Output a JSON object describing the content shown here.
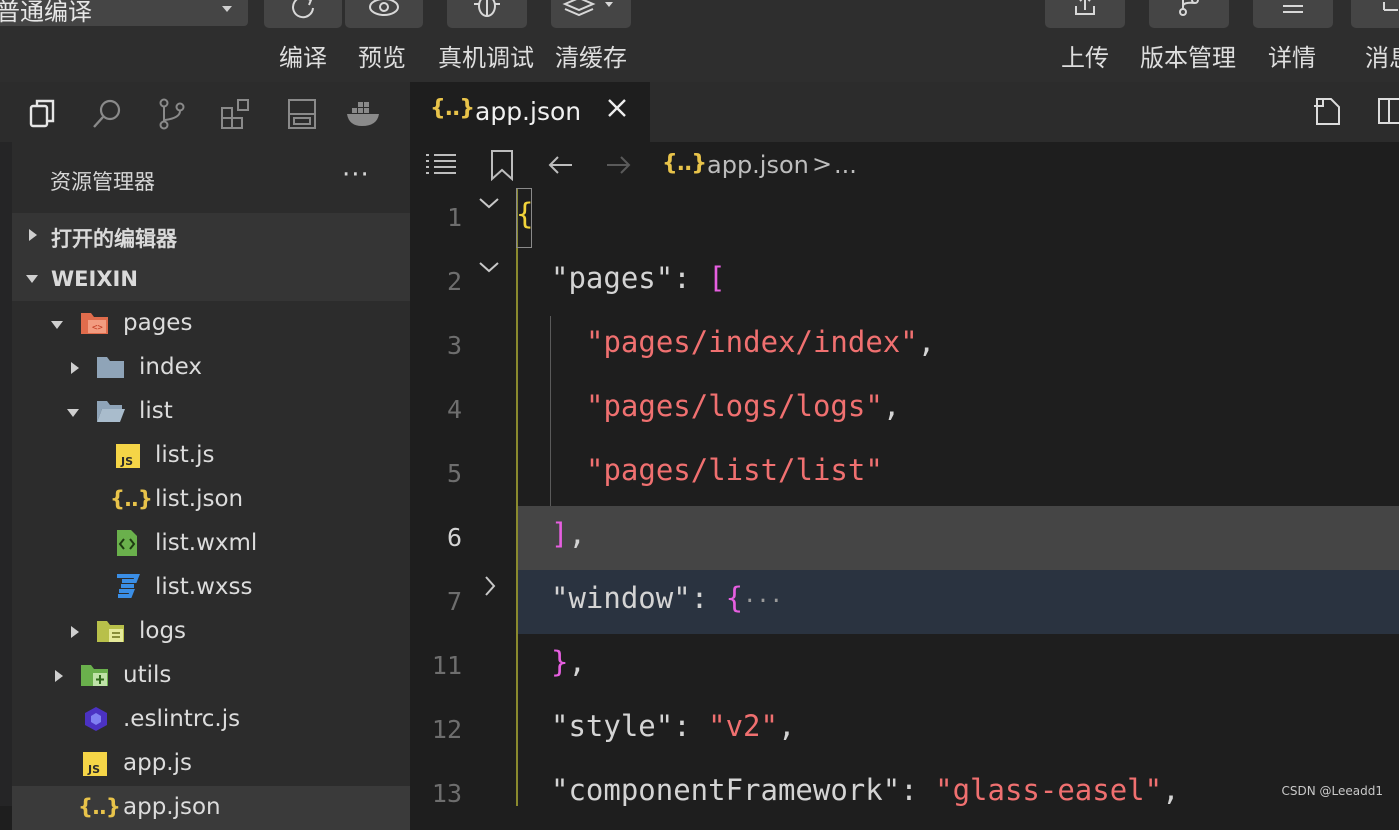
{
  "toolbar": {
    "compile_mode": "普通编译",
    "buttons": [
      {
        "label": "编译",
        "icon": "refresh-icon"
      },
      {
        "label": "预览",
        "icon": "eye-icon"
      },
      {
        "label": "真机调试",
        "icon": "bug-icon"
      },
      {
        "label": "清缓存",
        "icon": "layers-icon"
      }
    ],
    "right_buttons": [
      {
        "label": "上传",
        "icon": "upload-icon"
      },
      {
        "label": "版本管理",
        "icon": "branch-icon"
      },
      {
        "label": "详情",
        "icon": "menu-icon"
      },
      {
        "label": "消息",
        "icon": "bell-icon"
      }
    ]
  },
  "activity_bar": [
    "files-icon",
    "search-icon",
    "source-control-icon",
    "extensions-icon",
    "storage-icon",
    "docker-icon"
  ],
  "explorer": {
    "title": "资源管理器",
    "more": "···",
    "open_editors": "打开的编辑器",
    "workspace": "WEIXIN",
    "tree": [
      {
        "name": "pages",
        "type": "folder-pages",
        "expanded": true
      },
      {
        "name": "index",
        "type": "folder",
        "expanded": false
      },
      {
        "name": "list",
        "type": "folder",
        "expanded": true
      },
      {
        "name": "list.js",
        "type": "js"
      },
      {
        "name": "list.json",
        "type": "json"
      },
      {
        "name": "list.wxml",
        "type": "wxml"
      },
      {
        "name": "list.wxss",
        "type": "wxss"
      },
      {
        "name": "logs",
        "type": "folder-logs",
        "expanded": false
      },
      {
        "name": "utils",
        "type": "folder-utils",
        "expanded": false
      },
      {
        "name": ".eslintrc.js",
        "type": "eslint"
      },
      {
        "name": "app.js",
        "type": "js"
      },
      {
        "name": "app.json",
        "type": "json"
      }
    ]
  },
  "editor": {
    "tab_icon": "{..}",
    "tab_title": "app.json",
    "breadcrumb": {
      "icon": "{..}",
      "file": "app.json",
      "separator": ">",
      "tail": "..."
    },
    "lines": [
      {
        "num": "1",
        "text": "{"
      },
      {
        "num": "2",
        "key": "\"pages\"",
        "after": ": ",
        "bracket": "["
      },
      {
        "num": "3",
        "str": "\"pages/index/index\"",
        "tail": ","
      },
      {
        "num": "4",
        "str": "\"pages/logs/logs\"",
        "tail": ","
      },
      {
        "num": "5",
        "str": "\"pages/list/list\"",
        "tail": ""
      },
      {
        "num": "6",
        "bracket": "]",
        "tail": ","
      },
      {
        "num": "7",
        "key": "\"window\"",
        "after": ": ",
        "bracket": "{",
        "folded": "···"
      },
      {
        "num": "11",
        "bracket": "}",
        "tail": ","
      },
      {
        "num": "12",
        "key": "\"style\"",
        "after": ": ",
        "str": "\"v2\"",
        "tail": ","
      },
      {
        "num": "13",
        "key": "\"componentFramework\"",
        "after": ": ",
        "str": "\"glass-easel\"",
        "tail": ","
      }
    ]
  },
  "watermark": "CSDN @Leeadd1"
}
